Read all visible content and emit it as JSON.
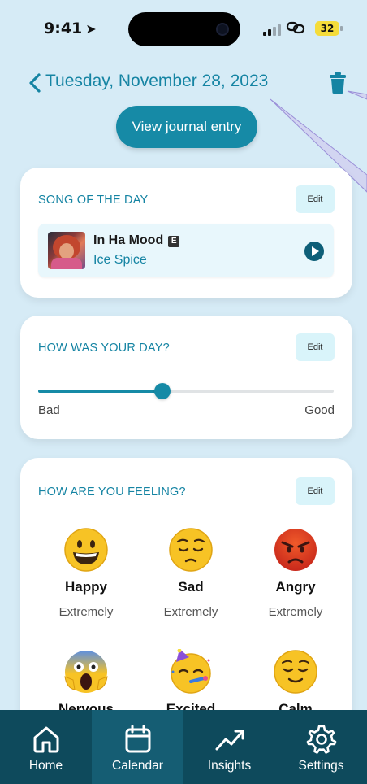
{
  "status_bar": {
    "time": "9:41",
    "battery": "32"
  },
  "header": {
    "date": "Tuesday, November 28, 2023"
  },
  "view_journal_label": "View journal entry",
  "song_card": {
    "title": "SONG OF THE DAY",
    "edit_label": "Edit",
    "song": {
      "name": "In Ha Mood",
      "explicit_badge": "E",
      "artist": "Ice Spice"
    }
  },
  "day_card": {
    "title": "HOW WAS YOUR DAY?",
    "edit_label": "Edit",
    "slider_value": 0.42,
    "min_label": "Bad",
    "max_label": "Good"
  },
  "feeling_card": {
    "title": "HOW ARE YOU FEELING?",
    "edit_label": "Edit",
    "emotions": [
      {
        "name": "Happy",
        "level": "Extremely",
        "icon": "grinning-face-icon"
      },
      {
        "name": "Sad",
        "level": "Extremely",
        "icon": "pensive-face-icon"
      },
      {
        "name": "Angry",
        "level": "Extremely",
        "icon": "angry-face-icon"
      },
      {
        "name": "Nervous",
        "level": "",
        "icon": "screaming-face-icon"
      },
      {
        "name": "Excited",
        "level": "",
        "icon": "partying-face-icon"
      },
      {
        "name": "Calm",
        "level": "",
        "icon": "relieved-face-icon"
      }
    ]
  },
  "tabs": [
    {
      "label": "Home",
      "icon": "home-icon"
    },
    {
      "label": "Calendar",
      "icon": "calendar-icon",
      "active": true
    },
    {
      "label": "Insights",
      "icon": "trending-up-icon"
    },
    {
      "label": "Settings",
      "icon": "gear-icon"
    }
  ],
  "colors": {
    "background": "#d6ebf6",
    "accent": "#168aa6",
    "tab_bar": "#0e4a5c"
  }
}
